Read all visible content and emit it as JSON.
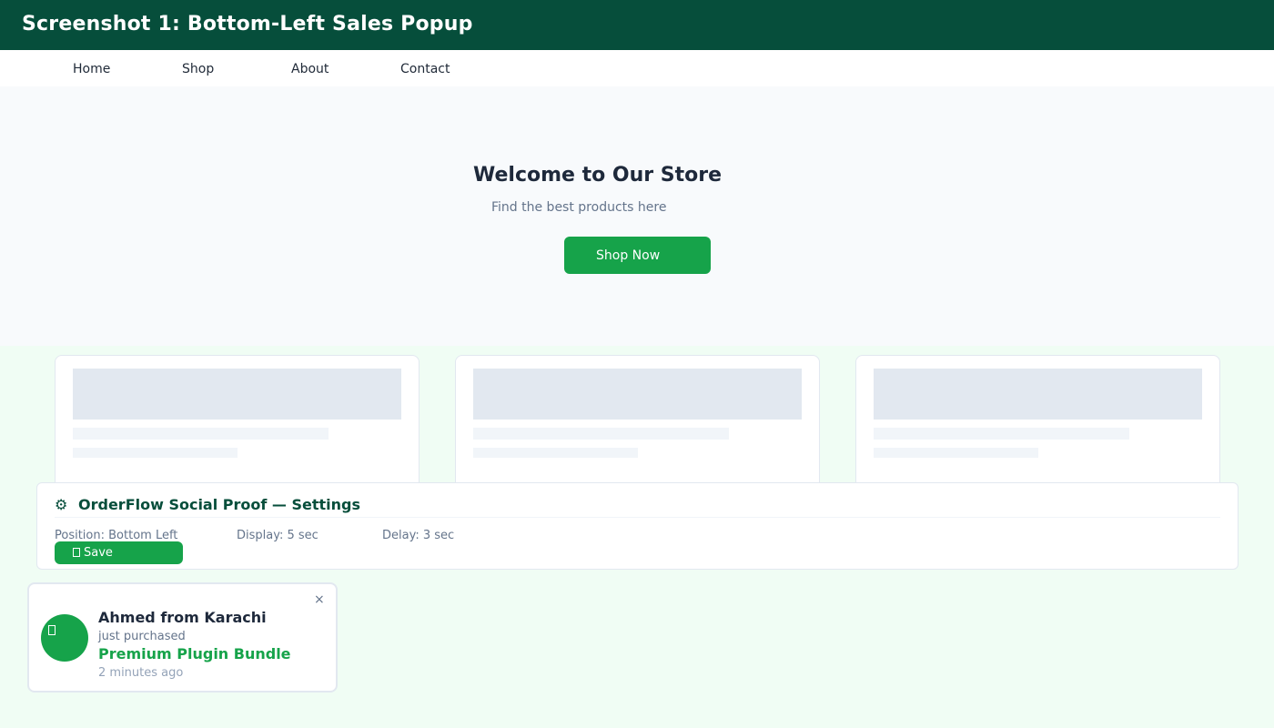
{
  "header": {
    "title": "Screenshot 1: Bottom-Left Sales Popup"
  },
  "nav": {
    "items": [
      "Home",
      "Shop",
      "About",
      "Contact"
    ]
  },
  "hero": {
    "title": "Welcome to Our Store",
    "subtitle": "Find the best products here",
    "cta_label": "Shop Now"
  },
  "settings": {
    "title": "OrderFlow Social Proof — Settings",
    "gear_icon": "⚙",
    "options": [
      "Position: Bottom Left",
      "Display: 5 sec",
      "Delay: 3 sec"
    ],
    "save_label": "Save"
  },
  "popup": {
    "name": "Ahmed from Karachi",
    "action": "just purchased",
    "product": "Premium Plugin Bundle",
    "time": "2 minutes ago",
    "close_icon": "×"
  },
  "colors": {
    "header_bg": "#064e3b",
    "accent": "#16a34a",
    "page_bg": "#f0fdf4"
  }
}
